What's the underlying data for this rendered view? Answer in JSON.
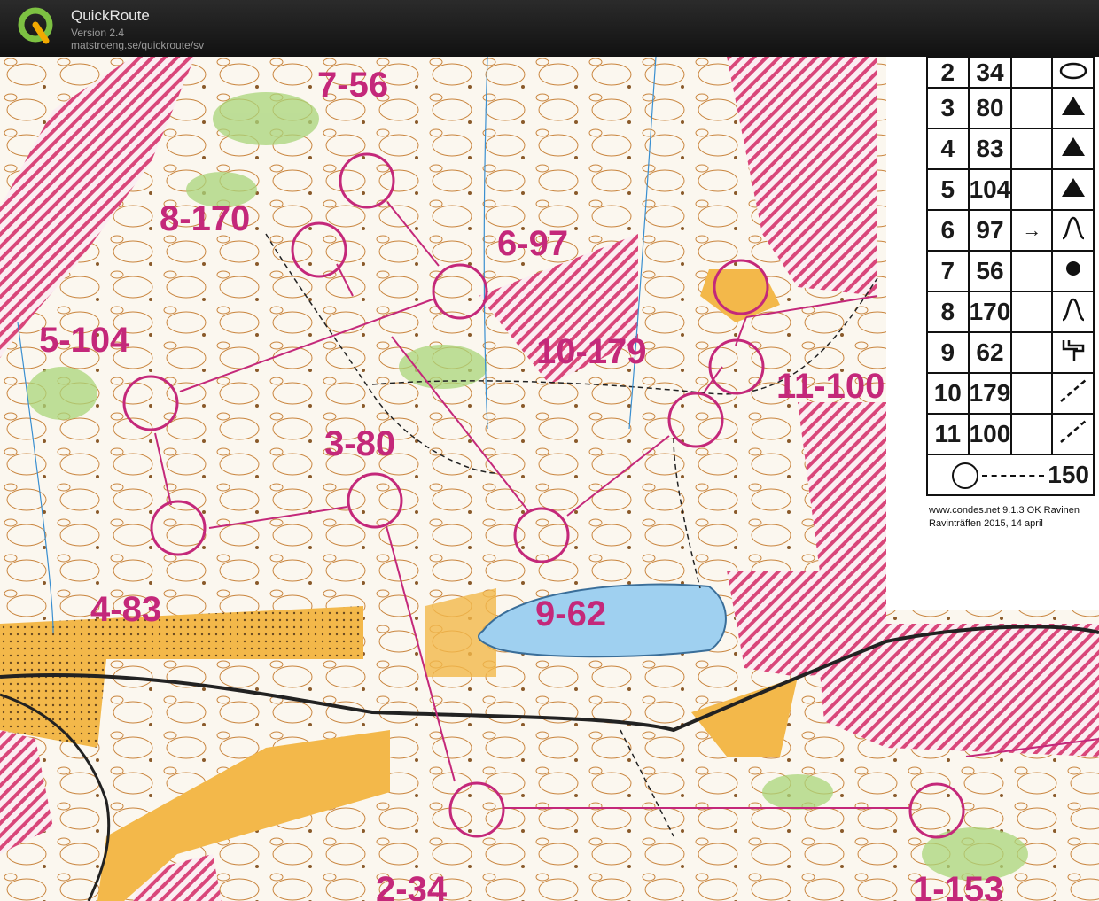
{
  "app": {
    "name": "QuickRoute",
    "version": "Version 2.4",
    "url": "matstroeng.se/quickroute/sv"
  },
  "colors": {
    "course": "#c4287a",
    "open_land": "#f3b84a",
    "water": "#9fd0f0",
    "vegetation": "#a9d57a",
    "contours": "#c9853e",
    "forbidden_hatch": "#d9467a"
  },
  "map_labels": {
    "c7": "7-56",
    "c8": "8-170",
    "c6": "6-97",
    "c5": "5-104",
    "c10": "10-179",
    "c11": "11-100",
    "c3": "3-80",
    "c4": "4-83",
    "c9": "9-62",
    "c2": "2-34",
    "c1": "1-153"
  },
  "control_descriptions": [
    {
      "seq": "2",
      "code": "34",
      "dir": "",
      "symbol": "oval"
    },
    {
      "seq": "3",
      "code": "80",
      "dir": "",
      "symbol": "triangle"
    },
    {
      "seq": "4",
      "code": "83",
      "dir": "",
      "symbol": "triangle"
    },
    {
      "seq": "5",
      "code": "104",
      "dir": "",
      "symbol": "triangle"
    },
    {
      "seq": "6",
      "code": "97",
      "dir": "→",
      "symbol": "knoll-bend"
    },
    {
      "seq": "7",
      "code": "56",
      "dir": "",
      "symbol": "dot"
    },
    {
      "seq": "8",
      "code": "170",
      "dir": "",
      "symbol": "knoll-bend"
    },
    {
      "seq": "9",
      "code": "62",
      "dir": "",
      "symbol": "fork"
    },
    {
      "seq": "10",
      "code": "179",
      "dir": "",
      "symbol": "diagonal-dashed"
    },
    {
      "seq": "11",
      "code": "100",
      "dir": "",
      "symbol": "diagonal-dashed"
    }
  ],
  "finish": {
    "distance": "150"
  },
  "credits": {
    "line1": "www.condes.net 9.1.3 OK Ravinen",
    "line2": "Ravinträffen 2015, 14 april"
  }
}
